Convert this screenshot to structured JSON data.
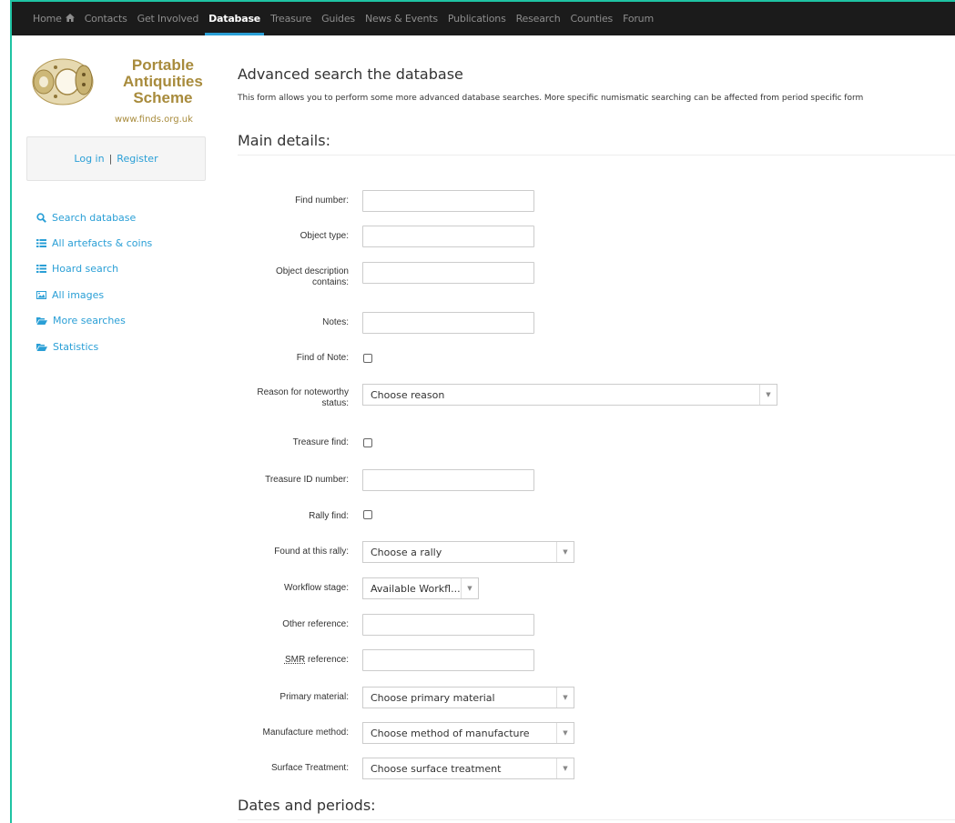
{
  "nav": {
    "items": [
      {
        "label": "Home",
        "icon": "home-icon",
        "active": false
      },
      {
        "label": "Contacts",
        "active": false
      },
      {
        "label": "Get Involved",
        "active": false
      },
      {
        "label": "Database",
        "active": true
      },
      {
        "label": "Treasure",
        "active": false
      },
      {
        "label": "Guides",
        "active": false
      },
      {
        "label": "News & Events",
        "active": false
      },
      {
        "label": "Publications",
        "active": false
      },
      {
        "label": "Research",
        "active": false
      },
      {
        "label": "Counties",
        "active": false
      },
      {
        "label": "Forum",
        "active": false
      }
    ]
  },
  "logo": {
    "line1": "Portable",
    "line2": "Antiquities",
    "line3": "Scheme",
    "url": "www.finds.org.uk"
  },
  "account": {
    "login": "Log in",
    "separator": "|",
    "register": "Register"
  },
  "sidebar": {
    "items": [
      {
        "label": "Search database",
        "icon": "search-icon"
      },
      {
        "label": "All artefacts & coins",
        "icon": "list-icon"
      },
      {
        "label": "Hoard search",
        "icon": "list-icon"
      },
      {
        "label": "All images",
        "icon": "image-icon"
      },
      {
        "label": "More searches",
        "icon": "folder-open-icon"
      },
      {
        "label": "Statistics",
        "icon": "folder-open-icon"
      }
    ]
  },
  "page": {
    "title": "Advanced search the database",
    "intro": "This form allows you to perform some more advanced database searches. More specific numismatic searching can be affected from period specific form",
    "section_main": "Main details:",
    "section_dates": "Dates and periods:"
  },
  "form": {
    "find_number": {
      "label": "Find number:",
      "value": ""
    },
    "object_type": {
      "label": "Object type:",
      "value": ""
    },
    "object_description": {
      "label_line1": "Object description",
      "label_line2": "contains:",
      "value": ""
    },
    "notes": {
      "label": "Notes:",
      "value": ""
    },
    "find_of_note": {
      "label": "Find of Note:",
      "checked": false
    },
    "noteworthy_reason": {
      "label_line1": "Reason for noteworthy",
      "label_line2": "status:",
      "selected": "Choose reason"
    },
    "treasure_find": {
      "label": "Treasure find:",
      "checked": false
    },
    "treasure_id": {
      "label": "Treasure ID number:",
      "value": ""
    },
    "rally_find": {
      "label": "Rally find:",
      "checked": false
    },
    "rally": {
      "label": "Found at this rally:",
      "selected": "Choose a rally"
    },
    "workflow": {
      "label": "Workflow stage:",
      "selected": "Available Workfl..."
    },
    "other_reference": {
      "label": "Other reference:",
      "value": ""
    },
    "smr_reference": {
      "label_abbr": "SMR",
      "label_rest": " reference:",
      "value": ""
    },
    "primary_material": {
      "label": "Primary material:",
      "selected": "Choose primary material"
    },
    "manufacture_method": {
      "label": "Manufacture method:",
      "selected": "Choose method of manufacture"
    },
    "surface_treatment": {
      "label": "Surface Treatment:",
      "selected": "Choose surface treatment"
    }
  }
}
